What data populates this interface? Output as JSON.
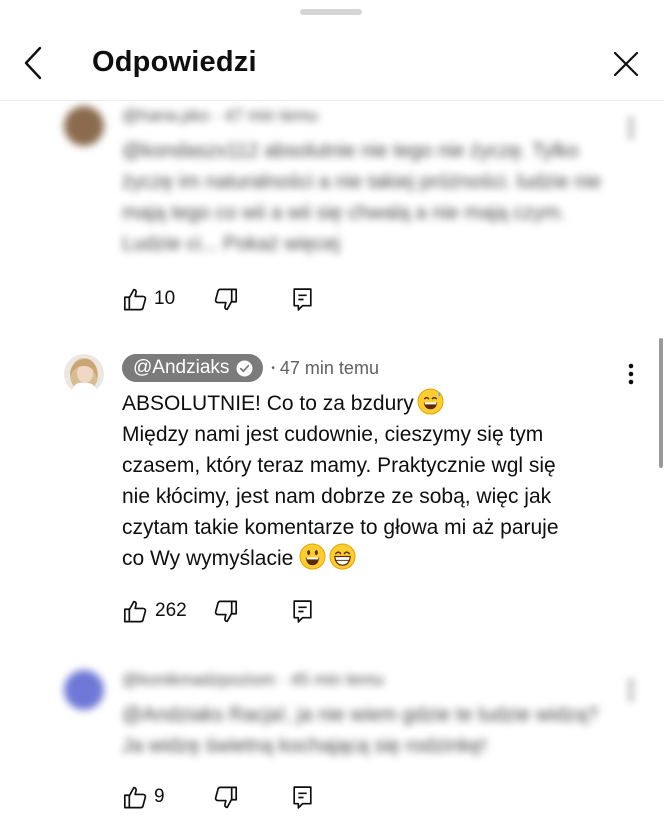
{
  "header": {
    "title": "Odpowiedzi",
    "back_icon": "chevron-left-icon",
    "close_icon": "close-icon"
  },
  "comments": [
    {
      "author": "@hana.pko",
      "time": "47 min temu",
      "text": "@kondaszx112 absolutnie nie tego nie życzę. Tylko życzę im naturalności a nie takiej próżności. ludzie nie mają tego co wii a wii się chwalą a nie mają czym. Ludzie ci... Pokaż więcej",
      "likes": "10",
      "blurred": true,
      "avatar_color": "#8a6b4e"
    },
    {
      "author": "@Andziaks",
      "time": "47 min temu",
      "text_lines": [
        "ABSOLUTNIE! Co to za bzdury",
        "Między nami jest cudownie, cieszymy się tym",
        "czasem, który teraz mamy. Praktycznie wgl się",
        "nie kłócimy, jest nam dobrze ze sobą, więc jak",
        "czytam takie komentarze to głowa mi aż paruje",
        "co Wy wymyślacie"
      ],
      "likes": "262",
      "blurred": false,
      "verified": true
    },
    {
      "author": "@konikmadzpoziom",
      "time": "45 min temu",
      "text": "@Andziaks Racja!, ja nie wiem gdzie te ludzie widzą? Ja widzę świetną kochającą się rodzinkę!",
      "likes": "9",
      "blurred": true,
      "avatar_color": "#6f78d6"
    }
  ],
  "icons": {
    "like": "thumbs-up-icon",
    "dislike": "thumbs-down-icon",
    "reply": "reply-icon",
    "more": "more-vertical-icon"
  }
}
